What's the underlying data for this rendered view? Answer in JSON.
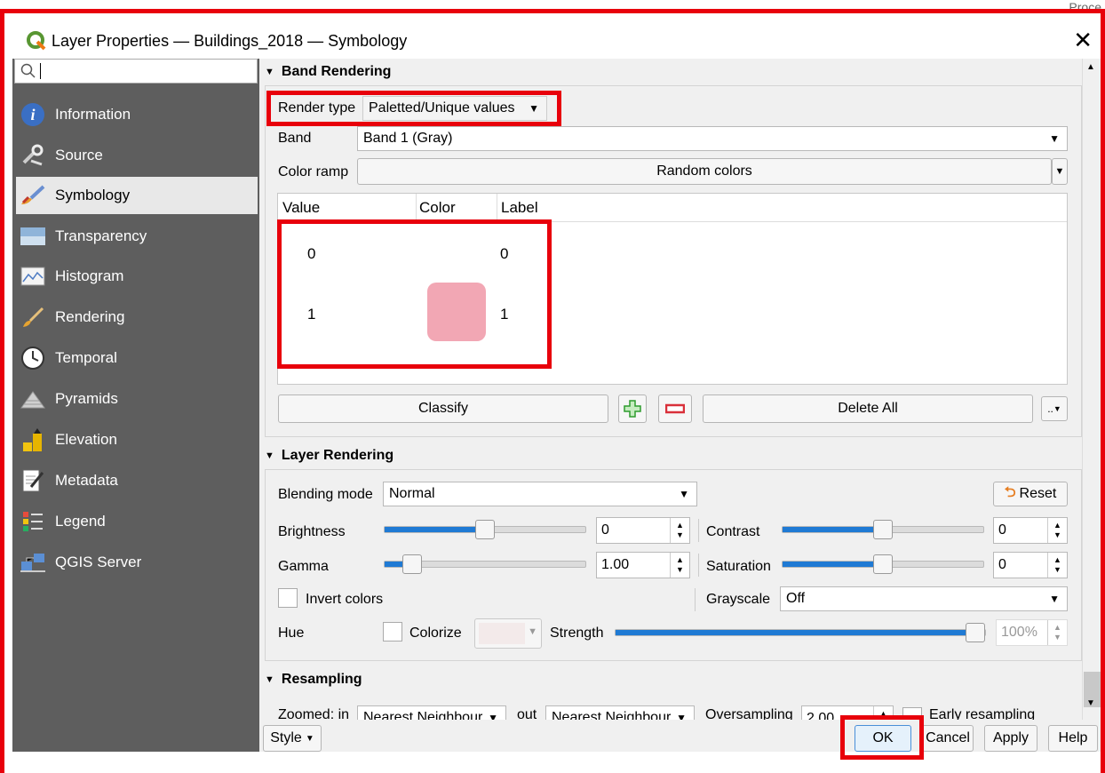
{
  "window": {
    "title": "Layer Properties — Buildings_2018 — Symbology",
    "close": "✕"
  },
  "sidebar": {
    "items": [
      {
        "label": "Information"
      },
      {
        "label": "Source"
      },
      {
        "label": "Symbology"
      },
      {
        "label": "Transparency"
      },
      {
        "label": "Histogram"
      },
      {
        "label": "Rendering"
      },
      {
        "label": "Temporal"
      },
      {
        "label": "Pyramids"
      },
      {
        "label": "Elevation"
      },
      {
        "label": "Metadata"
      },
      {
        "label": "Legend"
      },
      {
        "label": "QGIS Server"
      }
    ]
  },
  "band_rendering": {
    "title": "Band Rendering",
    "render_type_label": "Render type",
    "render_type_value": "Paletted/Unique values",
    "band_label": "Band",
    "band_value": "Band 1 (Gray)",
    "color_ramp_label": "Color ramp",
    "color_ramp_value": "Random colors",
    "table_headers": [
      "Value",
      "Color",
      "Label"
    ],
    "rows": [
      {
        "value": "0",
        "color": "",
        "label": "0"
      },
      {
        "value": "1",
        "color": "#f2a7b4",
        "label": "1"
      }
    ],
    "classify": "Classify",
    "delete_all": "Delete All",
    "more": ".."
  },
  "layer_rendering": {
    "title": "Layer Rendering",
    "blending_label": "Blending mode",
    "blending_value": "Normal",
    "reset": "Reset",
    "brightness_label": "Brightness",
    "brightness_value": "0",
    "brightness_level": 0.5,
    "contrast_label": "Contrast",
    "contrast_value": "0",
    "contrast_level": 0.5,
    "gamma_label": "Gamma",
    "gamma_value": "1.00",
    "gamma_level": 0.1,
    "saturation_label": "Saturation",
    "saturation_value": "0",
    "saturation_level": 0.5,
    "invert_label": "Invert colors",
    "grayscale_label": "Grayscale",
    "grayscale_value": "Off",
    "hue_label": "Hue",
    "colorize_label": "Colorize",
    "strength_label": "Strength",
    "strength_value": "100%",
    "strength_level": 1.0
  },
  "resampling": {
    "title": "Resampling",
    "zoomed_in_label": "Zoomed: in",
    "zoomed_in_value": "Nearest Neighbour",
    "out_label": "out",
    "out_value": "Nearest Neighbour",
    "oversampling_label": "Oversampling",
    "oversampling_value": "2.00",
    "early_label": "Early resampling"
  },
  "footer": {
    "style": "Style",
    "ok": "OK",
    "cancel": "Cancel",
    "apply": "Apply",
    "help": "Help"
  },
  "background_hint": "Proce",
  "colors": {
    "highlight": "#e8000b",
    "slider_fill": "#1f7ad4",
    "sidebar_bg": "#5e5e5e",
    "palette_swatch": "#f2a7b4"
  }
}
